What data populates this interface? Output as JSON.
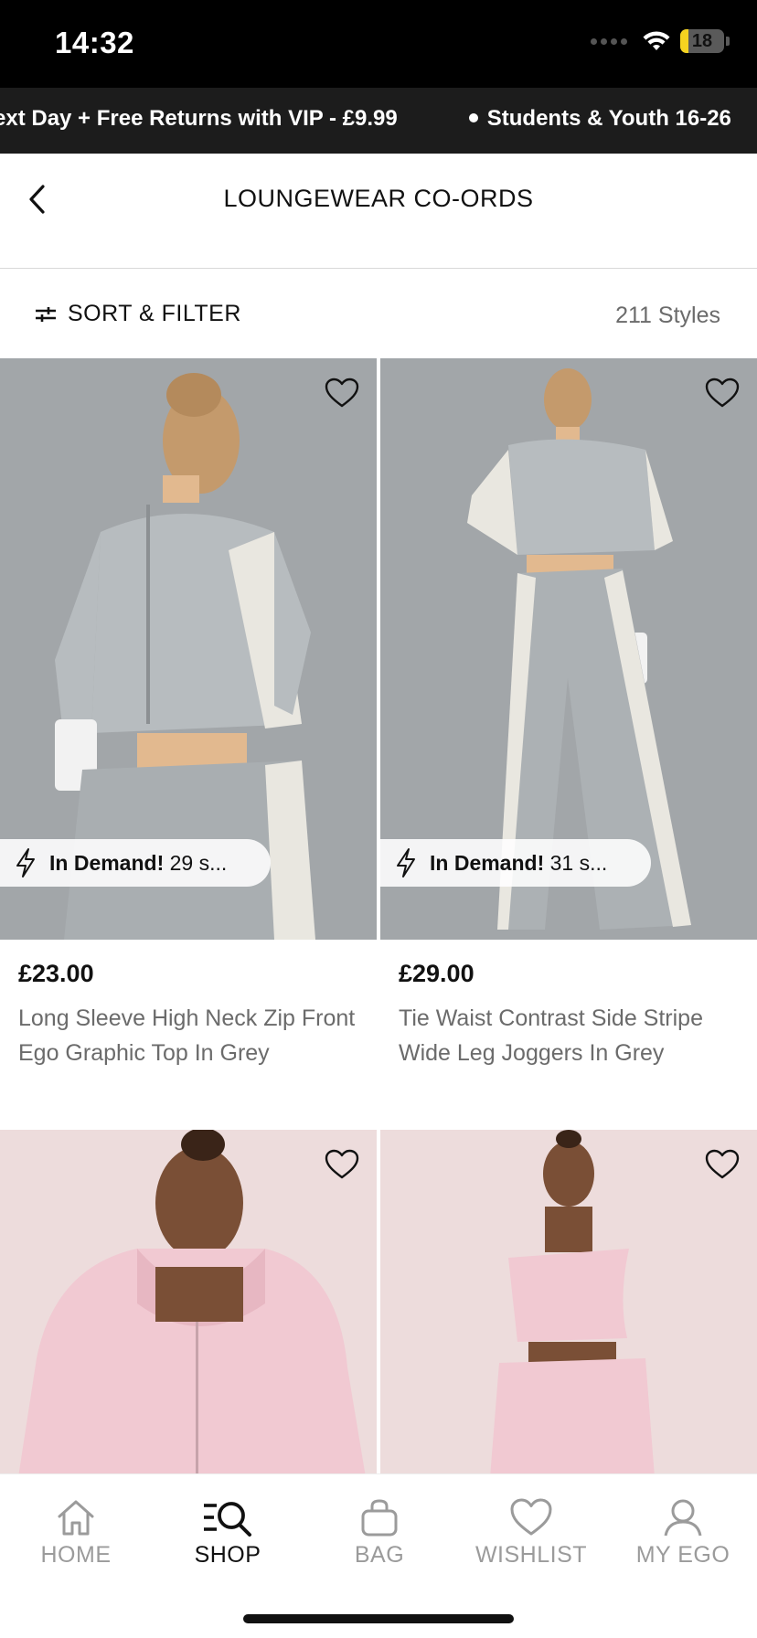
{
  "status_bar": {
    "time": "14:32",
    "battery_level": "18",
    "battery_fraction": 0.18
  },
  "promo_banner": {
    "items": [
      "ext Day + Free Returns with VIP - £9.99",
      "Students & Youth 16-26"
    ]
  },
  "header": {
    "back_icon": "chevron-left-icon",
    "title": "LOUNGEWEAR CO-ORDS"
  },
  "filter_bar": {
    "sort_filter_label": "SORT & FILTER",
    "styles_count": "211 Styles"
  },
  "products": [
    {
      "price": "£23.00",
      "name": "Long Sleeve High Neck Zip Front Ego Graphic Top In Grey",
      "badge_strong": "In Demand!",
      "badge_rest": "29 s...",
      "image_color": "#9ea3a6"
    },
    {
      "price": "£29.00",
      "name": "Tie Waist Contrast Side Stripe Wide Leg Joggers In Grey",
      "badge_strong": "In Demand!",
      "badge_rest": "31 s...",
      "image_color": "#9ea3a6"
    },
    {
      "image_color": "#ead8d8"
    },
    {
      "image_color": "#ead8d8"
    }
  ],
  "tab_bar": {
    "tabs": [
      {
        "label": "HOME",
        "icon": "home-icon"
      },
      {
        "label": "SHOP",
        "icon": "shop-search-icon",
        "active": true
      },
      {
        "label": "BAG",
        "icon": "bag-icon"
      },
      {
        "label": "WISHLIST",
        "icon": "heart-icon"
      },
      {
        "label": "MY EGO",
        "icon": "user-icon"
      }
    ]
  },
  "colors": {
    "status_bar_bg": "#000000",
    "banner_bg": "#1c1c1c",
    "muted_text": "#6b6b6b",
    "inactive_tab": "#9b9b9b",
    "battery_fill": "#f5d320"
  }
}
